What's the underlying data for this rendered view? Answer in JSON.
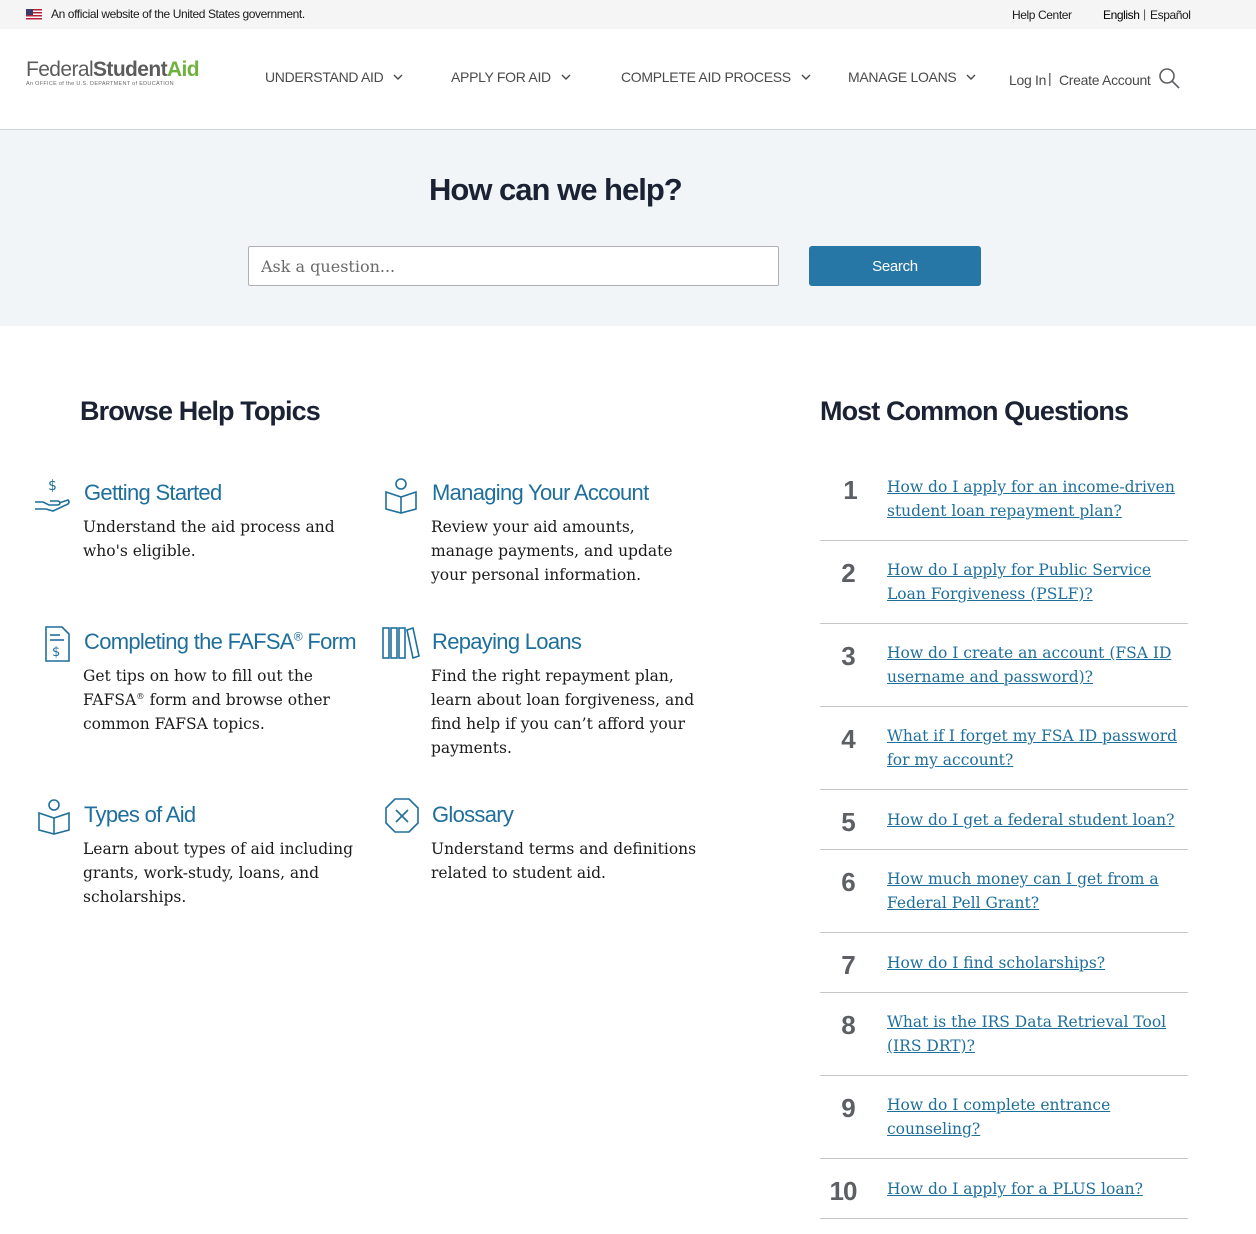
{
  "gov_banner": {
    "text": "An official website of the United States government.",
    "help_center": "Help Center",
    "lang_en": "English",
    "lang_sep": "|",
    "lang_es": "Español"
  },
  "header": {
    "logo_federal": "Federal",
    "logo_student": "Student",
    "logo_aid": "Aid",
    "logo_sub": "An OFFICE of the U.S. DEPARTMENT of EDUCATION",
    "nav": [
      "UNDERSTAND AID",
      "APPLY FOR AID",
      "COMPLETE AID PROCESS",
      "MANAGE LOANS"
    ],
    "login": "Log In",
    "sep": "|",
    "create_account": "Create Account"
  },
  "hero": {
    "title": "How can we help?",
    "search_placeholder": "Ask a question...",
    "search_button": "Search"
  },
  "browse": {
    "title": "Browse Help Topics",
    "topics": [
      {
        "title": "Getting Started",
        "desc": "Understand the aid process and who's eligible."
      },
      {
        "title": "Managing Your Account",
        "desc": "Review your aid amounts, manage payments, and update your personal information."
      },
      {
        "title": "Completing the FAFSA® Form",
        "title_pre": "Completing the FAFSA",
        "title_sup": "®",
        "title_post": " Form",
        "desc": "Get tips on how to fill out the FAFSA® form and browse other common FAFSA topics.",
        "desc_pre": "Get tips on how to fill out the FAFSA",
        "desc_sup": "®",
        "desc_post": " form and browse other common FAFSA topics."
      },
      {
        "title": "Repaying Loans",
        "desc": "Find the right repayment plan, learn about loan forgiveness, and find help if you can’t afford your payments."
      },
      {
        "title": "Types of Aid",
        "desc": "Learn about types of aid including grants, work-study, loans, and scholarships."
      },
      {
        "title": "Glossary",
        "desc": "Understand terms and definitions related to student aid."
      }
    ]
  },
  "common": {
    "title": "Most Common Questions",
    "questions": [
      {
        "num": "1",
        "text": "How do I apply for an income-driven student loan repayment plan? "
      },
      {
        "num": "2",
        "text": "How do I apply for Public Service Loan Forgiveness (PSLF)?"
      },
      {
        "num": "3",
        "text": "How do I create an account (FSA ID username and password)?"
      },
      {
        "num": "4",
        "text": "What if I forget my FSA ID password for my account?"
      },
      {
        "num": "5",
        "text": "How do I get a federal student loan?"
      },
      {
        "num": "6",
        "text": "How much money can I get from a Federal Pell Grant?"
      },
      {
        "num": "7",
        "text": "How do I find scholarships?"
      },
      {
        "num": "8",
        "text": "What is the IRS Data Retrieval Tool (IRS DRT)?"
      },
      {
        "num": "9",
        "text": "How do I complete entrance counseling?"
      },
      {
        "num": "10",
        "text": "How do I apply for a PLUS loan? "
      }
    ]
  },
  "colors": {
    "link": "#1f6f9c",
    "button": "#2677a6",
    "logo_aid": "#6fb23e",
    "hero_bg": "#f1f5f8"
  }
}
